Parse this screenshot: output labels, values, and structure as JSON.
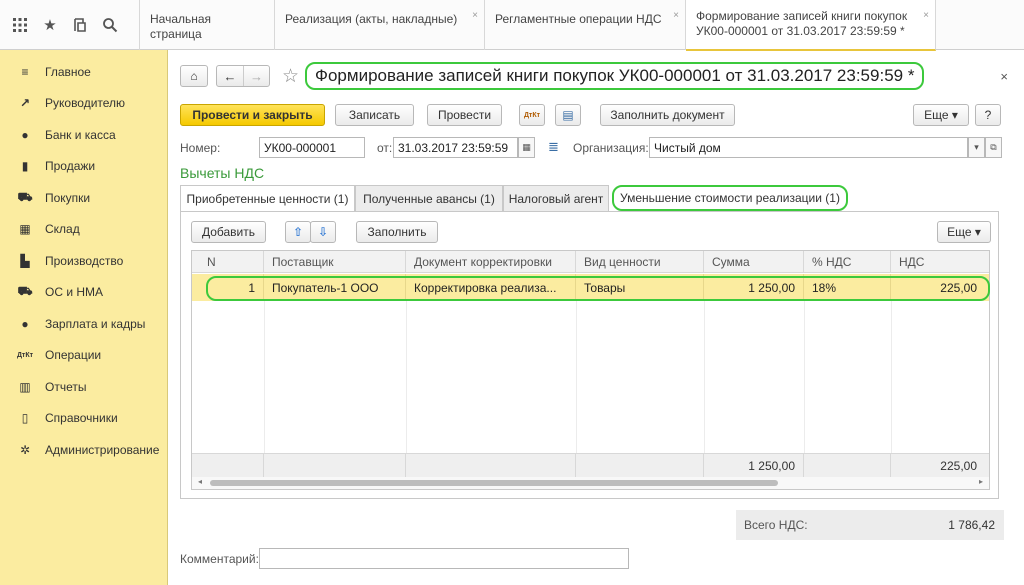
{
  "tabs": [
    {
      "label": "Начальная страница"
    },
    {
      "label": "Реализация (акты, накладные)",
      "close": "×"
    },
    {
      "label": "Регламентные операции НДС",
      "close": "×"
    },
    {
      "label": "Формирование записей книги покупок",
      "label2": "УК00-000001 от 31.03.2017 23:59:59 *",
      "close": "×"
    }
  ],
  "top_icons": [
    "apps-icon",
    "star-icon",
    "history-icon",
    "search-icon"
  ],
  "sidebar": {
    "items": [
      {
        "label": "Главное",
        "icon": "≡"
      },
      {
        "label": "Руководителю",
        "icon": "↗"
      },
      {
        "label": "Банк и касса",
        "icon": "●"
      },
      {
        "label": "Продажи",
        "icon": "▮"
      },
      {
        "label": "Покупки",
        "icon": "⛟"
      },
      {
        "label": "Склад",
        "icon": "▦"
      },
      {
        "label": "Производство",
        "icon": "▙"
      },
      {
        "label": "ОС и НМА",
        "icon": "⛟"
      },
      {
        "label": "Зарплата и кадры",
        "icon": "●"
      },
      {
        "label": "Операции",
        "icon": "ДтКт"
      },
      {
        "label": "Отчеты",
        "icon": "▥"
      },
      {
        "label": "Справочники",
        "icon": "▯"
      },
      {
        "label": "Администрирование",
        "icon": "✲"
      }
    ]
  },
  "header": {
    "title": "Формирование записей книги покупок УК00-000001 от 31.03.2017 23:59:59 *",
    "close": "×",
    "home": "⌂",
    "back": "←",
    "forward": "→",
    "star": "☆"
  },
  "toolbar": {
    "post_close": "Провести и закрыть",
    "save": "Записать",
    "post": "Провести",
    "dtkt": "ДтКт",
    "report": "▤",
    "fill_doc": "Заполнить документ",
    "more": "Еще ▾",
    "help": "?"
  },
  "fields": {
    "number_label": "Номер:",
    "number_value": "УК00-000001",
    "date_label": "от:",
    "date_value": "31.03.2017 23:59:59",
    "calendar": "▦",
    "org_label": "Организация:",
    "org_value": "Чистый дом",
    "org_dropdown": "▾",
    "org_open": "⧉"
  },
  "section_title": "Вычеты НДС",
  "inner_tabs": [
    "Приобретенные ценности (1)",
    "Полученные авансы (1)",
    "Налоговый агент",
    "Уменьшение стоимости реализации (1)"
  ],
  "panel_toolbar": {
    "add": "Добавить",
    "up": "⇧",
    "down": "⇩",
    "fill": "Заполнить",
    "more": "Еще ▾"
  },
  "table": {
    "columns": [
      "N",
      "Поставщик",
      "Документ корректировки",
      "Вид ценности",
      "Сумма",
      "% НДС",
      "НДС"
    ],
    "rows": [
      {
        "n": "1",
        "supplier": "Покупатель-1 ООО",
        "doc": "Корректировка реализа...",
        "kind": "Товары",
        "sum": "1 250,00",
        "rate": "18%",
        "vat": "225,00"
      }
    ],
    "footer": {
      "sum": "1 250,00",
      "vat": "225,00"
    },
    "scroll_left": "◂",
    "scroll_right": "▸"
  },
  "total": {
    "label": "Всего НДС:",
    "value": "1 786,42"
  },
  "comment_label": "Комментарий:",
  "comment_value": ""
}
